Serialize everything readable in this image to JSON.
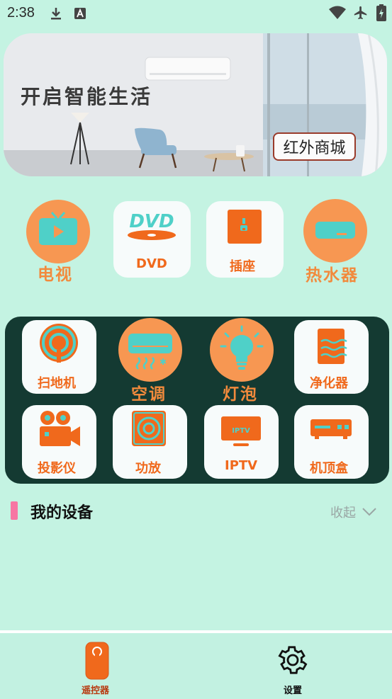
{
  "status_bar": {
    "time": "2:38",
    "icons": [
      "download-icon",
      "a-notification-icon",
      "wifi-icon",
      "airplane-icon",
      "battery-icon"
    ]
  },
  "banner": {
    "slogan": "开启智能生活",
    "button_label": "红外商城"
  },
  "categories_top": [
    {
      "label": "电视",
      "icon": "tv-icon"
    },
    {
      "label": "DVD",
      "icon": "dvd-icon"
    },
    {
      "label": "插座",
      "icon": "socket-icon"
    },
    {
      "label": "热水器",
      "icon": "water-heater-icon"
    }
  ],
  "categories_panel": [
    {
      "label": "扫地机",
      "icon": "robot-vacuum-icon"
    },
    {
      "label": "空调",
      "icon": "air-conditioner-icon"
    },
    {
      "label": "灯泡",
      "icon": "light-bulb-icon"
    },
    {
      "label": "净化器",
      "icon": "purifier-icon"
    },
    {
      "label": "投影仪",
      "icon": "projector-icon"
    },
    {
      "label": "功放",
      "icon": "amplifier-icon"
    },
    {
      "label": "IPTV",
      "icon": "iptv-icon"
    },
    {
      "label": "机顶盒",
      "icon": "set-top-box-icon"
    }
  ],
  "iptv_screen_text": "IPTV",
  "dvd_logo_text": "DVD",
  "my_devices": {
    "title": "我的设备",
    "collapse_label": "收起"
  },
  "bottom_nav": [
    {
      "label": "遥控器",
      "icon": "remote-icon",
      "active": true
    },
    {
      "label": "设置",
      "icon": "gear-icon",
      "active": false
    }
  ],
  "colors": {
    "background": "#c4f3e2",
    "accent_orange": "#f79752",
    "label_orange": "#f0691c",
    "icon_teal": "#4fd0c8",
    "panel_dark": "#143a32",
    "section_pink": "#f776a3"
  }
}
